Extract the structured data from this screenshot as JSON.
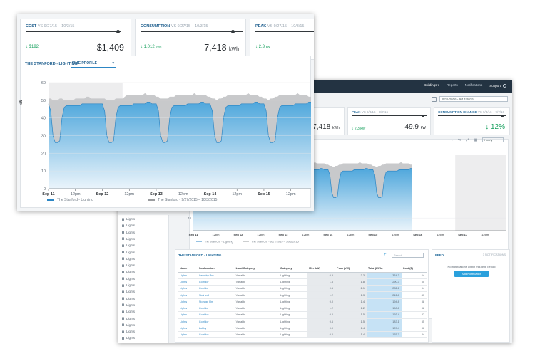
{
  "front": {
    "cards": [
      {
        "label": "COST",
        "range": "VS 9/27/15 – 10/3/15",
        "delta": "↓ $192",
        "delta_unit": "",
        "value": "$1,409",
        "unit": ""
      },
      {
        "label": "CONSUMPTION",
        "range": "VS 9/27/15 – 10/3/15",
        "delta": "↓ 1,012",
        "delta_unit": "kWh",
        "value": "7,418",
        "unit": "kWh"
      },
      {
        "label": "PEAK",
        "range": "VS 9/27/15 – 10/3/15",
        "delta": "↓ 2.3",
        "delta_unit": "kW",
        "value": "",
        "unit": ""
      }
    ],
    "chart_title": "THE STANFORD - LIGHTING",
    "dropdown": "TIME PROFILE",
    "ylabel": "kW",
    "yticks": [
      "60",
      "50",
      "40",
      "30",
      "20",
      "10",
      "0"
    ],
    "xticks": [
      {
        "label": "Sep 11",
        "bold": true
      },
      {
        "label": "12pm",
        "bold": false
      },
      {
        "label": "Sep 12",
        "bold": true
      },
      {
        "label": "12pm",
        "bold": false
      },
      {
        "label": "Sep 13",
        "bold": true
      },
      {
        "label": "12pm",
        "bold": false
      },
      {
        "label": "Sep 14",
        "bold": true
      },
      {
        "label": "12pm",
        "bold": false
      },
      {
        "label": "Sep 15",
        "bold": true
      },
      {
        "label": "12pm",
        "bold": false
      }
    ],
    "legend": [
      "The Stanford - Lighting",
      "The Stanford - 9/27/2015 – 10/3/2015"
    ]
  },
  "back": {
    "nav": [
      "Buildings ▾",
      "Reports",
      "Notifications",
      "Support"
    ],
    "date_range": "9/11/2016 - 9/17/2016",
    "cards": [
      {
        "label": "",
        "range": "",
        "value": "7,418",
        "unit": "kWh",
        "delta": ""
      },
      {
        "label": "PEAK",
        "range": "VS 9/3/16 – 9/7/16",
        "value": "49.9",
        "unit": "kW",
        "delta": "↓ 2.3 kW"
      },
      {
        "label": "CONSUMPTION CHANGE",
        "range": "VS 9/3/16 – 9/7/16",
        "value": "12%",
        "unit": "",
        "delta": "↓"
      }
    ],
    "hour_select": "Hourly",
    "y_tick": "10",
    "xticks": [
      "Sep 11",
      "12pm",
      "Sep 12",
      "12pm",
      "Sep 13",
      "12pm",
      "Sep 14",
      "12pm",
      "Sep 15",
      "12pm",
      "Sep 16",
      "12pm",
      "Sep 17",
      "12pm"
    ],
    "legend": [
      "The Stanford - Lighting",
      "The Stanford - 9/27/2015 – 10/3/2015"
    ],
    "sidebar_items": [
      "Lights",
      "Lights",
      "Lights",
      "Lights",
      "Lights",
      "Lights",
      "Lights",
      "Lights",
      "Lights",
      "Lights",
      "Lights",
      "Lights",
      "Lights",
      "Lights",
      "Lights",
      "Lights",
      "Lights",
      "Lights",
      "Lights"
    ],
    "table": {
      "title": "THE STANFORD - LIGHTING",
      "search_placeholder": "Search",
      "headers": [
        "Name",
        "Sublocation",
        "Load Category",
        "Category",
        "Min (kW)",
        "Peak (kW)",
        "Total (kWh)",
        "Cost ($)"
      ],
      "rows": [
        [
          "Lights",
          "Laundry Rm",
          "Variable",
          "Lighting",
          "0.5",
          "3.3",
          "334.3",
          "64"
        ],
        [
          "Lights",
          "Corridor",
          "Variable",
          "Lighting",
          "1.6",
          "1.8",
          "290.3",
          "55"
        ],
        [
          "Lights",
          "Corridor",
          "Variable",
          "Lighting",
          "0.6",
          "2.1",
          "282.6",
          "54"
        ],
        [
          "Lights",
          "Stairwell",
          "Variable",
          "Lighting",
          "1.2",
          "1.3",
          "212.8",
          "41"
        ],
        [
          "Lights",
          "Storage Rm",
          "Variable",
          "Lighting",
          "0.0",
          "1.4",
          "194.8",
          "38"
        ],
        [
          "Lights",
          "Corridor",
          "Variable",
          "Lighting",
          "1.2",
          "1.2",
          "198.8",
          "38"
        ],
        [
          "Lights",
          "Corridor",
          "Variable",
          "Lighting",
          "0.0",
          "1.5",
          "193.4",
          "37"
        ],
        [
          "Lights",
          "Corridor",
          "Variable",
          "Lighting",
          "0.6",
          "1.5",
          "183.1",
          "35"
        ],
        [
          "Lights",
          "Lobby",
          "Variable",
          "Lighting",
          "0.0",
          "1.4",
          "187.4",
          "36"
        ],
        [
          "Lights",
          "Corridor",
          "Variable",
          "Lighting",
          "0.0",
          "1.4",
          "176.7",
          "34"
        ]
      ]
    },
    "feed": {
      "title": "FEED",
      "right": "3 NOTIFICATIONS",
      "message": "No notifications within this time period",
      "button": "Add Notification"
    }
  },
  "colors": {
    "area_blue": "#4fa7dc",
    "area_gray": "#c8c9cb",
    "accent": "#1f5f8e",
    "green": "#16a05d"
  },
  "chart_data": [
    {
      "type": "area",
      "title": "THE STANFORD - LIGHTING",
      "ylabel": "kW",
      "ylim": [
        0,
        60
      ],
      "x_hours_from_sep11": [
        0,
        1,
        2,
        3,
        4,
        5,
        6,
        7,
        8,
        9,
        10,
        11,
        12,
        13,
        14,
        15,
        16,
        17,
        18,
        19,
        20,
        21,
        22,
        23,
        24,
        25,
        26,
        27,
        28,
        29,
        30,
        31,
        32,
        33,
        34,
        35,
        36,
        37,
        38,
        39,
        40,
        41,
        42,
        43,
        44,
        45,
        46,
        47,
        48,
        49,
        50,
        51,
        52,
        53,
        54,
        55,
        56,
        57,
        58,
        59,
        60,
        61,
        62,
        63,
        64,
        65,
        66,
        67,
        68,
        69,
        70,
        71,
        72,
        73,
        74,
        75,
        76,
        77,
        78,
        79,
        80,
        81,
        82,
        83,
        84,
        85,
        86,
        87,
        88,
        89,
        90,
        91,
        92,
        93,
        94,
        95,
        96,
        97,
        98,
        99,
        100,
        101,
        102,
        103,
        104,
        105,
        106,
        107,
        108,
        109,
        110,
        111,
        112,
        113,
        114,
        115,
        116,
        117
      ],
      "series": [
        {
          "name": "The Stanford - Lighting",
          "values": [
            48,
            44,
            30,
            26,
            26,
            27,
            40,
            46,
            47,
            47,
            47,
            47,
            47,
            47,
            47,
            48,
            48,
            48,
            48,
            48,
            48,
            48,
            48,
            48,
            48,
            44,
            30,
            26,
            26,
            27,
            40,
            46,
            47,
            47,
            47,
            47,
            47,
            47,
            48,
            48,
            48,
            48,
            48,
            48,
            49,
            49,
            48,
            48,
            48,
            44,
            30,
            26,
            26,
            27,
            40,
            46,
            47,
            47,
            47,
            47,
            47,
            47,
            48,
            48,
            48,
            48,
            48,
            48,
            49,
            49,
            48,
            48,
            48,
            44,
            30,
            26,
            26,
            27,
            40,
            46,
            47,
            47,
            47,
            47,
            47,
            47,
            48,
            48,
            48,
            48,
            48,
            48,
            49,
            49,
            48,
            48,
            48,
            44,
            30,
            26,
            26,
            27,
            40,
            46,
            47,
            47,
            47,
            47,
            47,
            47,
            48,
            48,
            48,
            48,
            48,
            48,
            49,
            49
          ]
        },
        {
          "name": "The Stanford - 9/27/2015 – 10/3/2015",
          "values": [
            51,
            51,
            50,
            50,
            50,
            51,
            51,
            50,
            50,
            50,
            50,
            50,
            51,
            51,
            51,
            51,
            51,
            52,
            52,
            51,
            51,
            51,
            51,
            51,
            51,
            51,
            50,
            50,
            50,
            50,
            51,
            51,
            51,
            51,
            52,
            53,
            53,
            53,
            53,
            53,
            53,
            53,
            53,
            54,
            53,
            53,
            53,
            53,
            52,
            52,
            51,
            51,
            51,
            51,
            52,
            52,
            52,
            53,
            53,
            53,
            53,
            53,
            53,
            53,
            53,
            54,
            53,
            53,
            53,
            53,
            53,
            52,
            52,
            51,
            51,
            50,
            51,
            51,
            52,
            52,
            53,
            53,
            53,
            53,
            53,
            53,
            53,
            53,
            53,
            54,
            53,
            53,
            53,
            53,
            52,
            52,
            51,
            51,
            50,
            51,
            51,
            52,
            52,
            53,
            53,
            53,
            53,
            53,
            53,
            53,
            53,
            54,
            53,
            53,
            53,
            53,
            52,
            52
          ]
        }
      ]
    }
  ]
}
